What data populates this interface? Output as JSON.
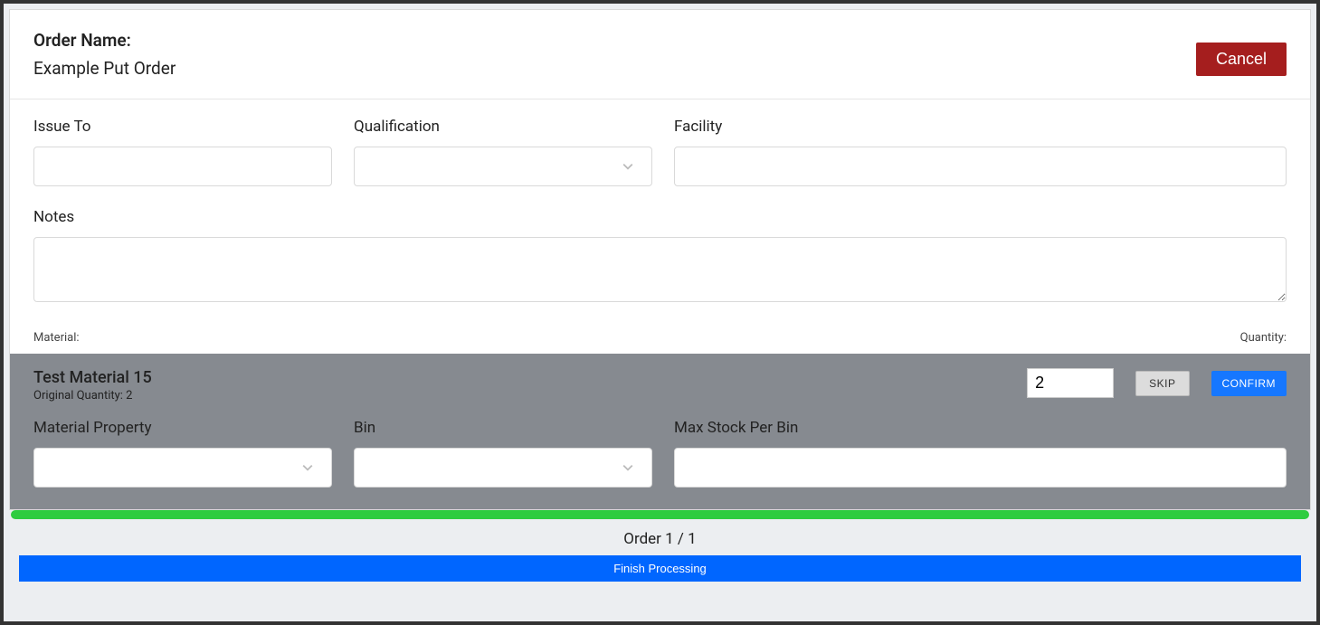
{
  "header": {
    "order_name_label": "Order Name:",
    "order_name_value": "Example Put Order",
    "cancel_label": "Cancel"
  },
  "form": {
    "issue_to_label": "Issue To",
    "issue_to_value": "",
    "qualification_label": "Qualification",
    "qualification_value": "",
    "facility_label": "Facility",
    "facility_value": "",
    "notes_label": "Notes",
    "notes_value": ""
  },
  "meta": {
    "material_label": "Material:",
    "quantity_label": "Quantity:"
  },
  "line_item": {
    "material_name": "Test Material 15",
    "original_qty_label": "Original Quantity: 2",
    "qty_value": "2",
    "skip_label": "SKIP",
    "confirm_label": "CONFIRM",
    "material_property_label": "Material Property",
    "material_property_value": "",
    "bin_label": "Bin",
    "bin_value": "",
    "max_stock_label": "Max Stock Per Bin",
    "max_stock_value": ""
  },
  "footer": {
    "page_indicator": "Order 1 / 1",
    "finish_label": "Finish Processing"
  }
}
